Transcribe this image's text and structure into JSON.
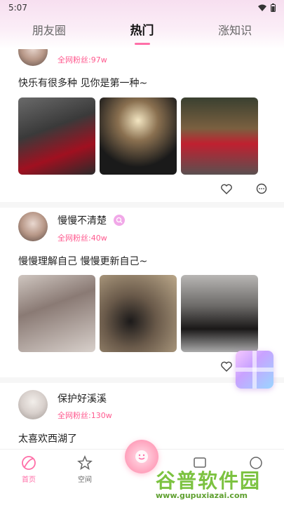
{
  "status_bar": {
    "time": "5:07"
  },
  "tabs": [
    {
      "label": "朋友圈"
    },
    {
      "label": "热门"
    },
    {
      "label": "涨知识"
    }
  ],
  "posts": [
    {
      "username": "",
      "fans": "全网粉丝:97w",
      "text": "快乐有很多种 见你是第一种~"
    },
    {
      "username": "慢慢不清楚",
      "fans": "全网粉丝:40w",
      "text": "慢慢理解自己 慢慢更新自己~"
    },
    {
      "username": "保护好溪溪",
      "fans": "全网粉丝:130w",
      "text": "太喜欢西湖了"
    }
  ],
  "bottom_nav": [
    {
      "label": "首页",
      "icon": "home-icon"
    },
    {
      "label": "空间",
      "icon": "star-icon"
    },
    {
      "label": "",
      "icon": "message-icon"
    },
    {
      "label": "",
      "icon": "profile-icon"
    }
  ],
  "watermark": {
    "title": "谷普软件园",
    "url": "www.gupuxiazai.com"
  },
  "colors": {
    "accent": "#ff6fa8",
    "fans_text": "#ff5a8f"
  }
}
